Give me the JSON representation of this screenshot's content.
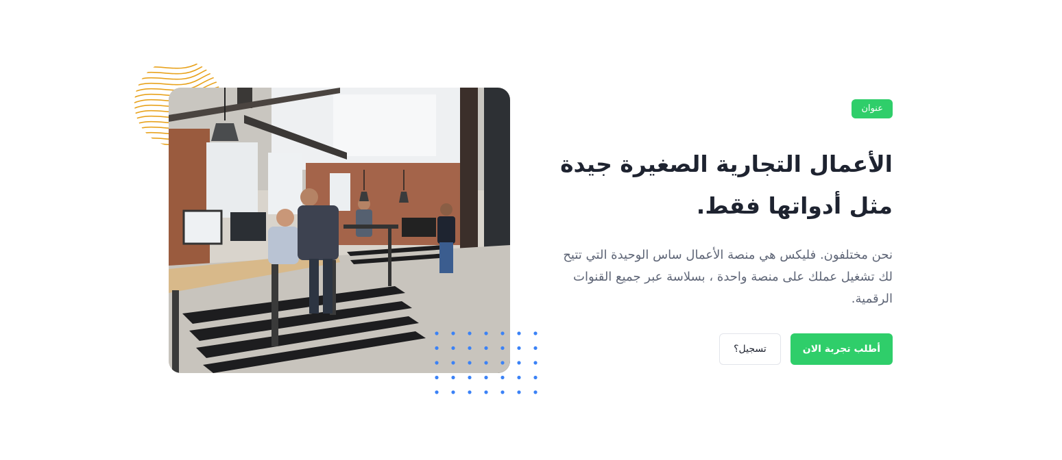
{
  "hero": {
    "badge": "عنوان",
    "title": "الأعمال التجارية الصغيرة جيدة مثل أدواتها فقط.",
    "description": "نحن مختلفون. فليكس هي منصة الأعمال ساس الوحيدة التي تتيح لك تشغيل عملك على منصة واحدة ، بسلاسة عبر جميع القنوات الرقمية.",
    "primary_button": "أطلب تجربة الان",
    "secondary_button": "تسجيل؟",
    "image_icon": "office-photo",
    "colors": {
      "accent": "#2fce6a",
      "heading": "#1e2330",
      "body_text": "#5e6576",
      "lines_decoration": "#e8a21c",
      "dots_decoration": "#3b82f6"
    }
  }
}
